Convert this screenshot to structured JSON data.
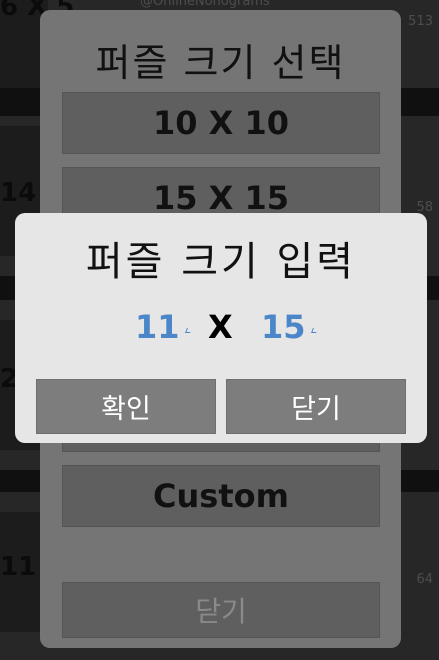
{
  "background": {
    "rows": [
      {
        "size_label": "6 X 5",
        "count": "513",
        "subtitle": "@OnlineNonograms"
      },
      {
        "size_label": "14 X",
        "count": "58"
      },
      {
        "size_label": "2",
        "count": ""
      },
      {
        "size_label": "11 X",
        "count": "64"
      }
    ]
  },
  "size_dialog": {
    "title": "퍼즐 크기 선택",
    "options": [
      {
        "label": "10 X 10"
      },
      {
        "label": "15 X 15"
      },
      {
        "label": ""
      },
      {
        "label": ""
      },
      {
        "label": "Custom"
      }
    ],
    "close_label": "닫기"
  },
  "input_dialog": {
    "title": "퍼즐 크기 입력",
    "width_value": "11",
    "separator": "X",
    "height_value": "15",
    "confirm_label": "확인",
    "close_label": "닫기"
  },
  "colors": {
    "input_value": "#4a86c8",
    "dialog_bg": "#e6e6e6",
    "button_bg": "#7d7d7d"
  }
}
